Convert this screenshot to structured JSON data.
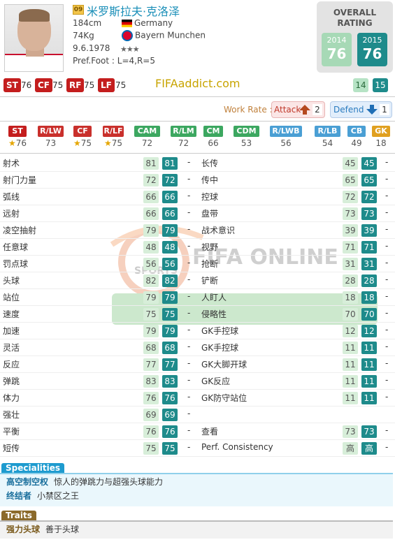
{
  "player": {
    "season_badge": "09",
    "name": "米罗斯拉夫·克洛泽",
    "height": "184cm",
    "weight": "74Kg",
    "birth": "9.6.1978",
    "pref_foot": "Pref.Foot : L=4,R=5",
    "nation": "Germany",
    "club": "Bayern Munchen",
    "stars": "★★★"
  },
  "overall": {
    "title1": "OVERALL",
    "title2": "RATING",
    "y1_label": "2014",
    "y1_value": "76",
    "y2_label": "2015",
    "y2_value": "76"
  },
  "top_positions": [
    {
      "pos": "ST",
      "val": "76"
    },
    {
      "pos": "CF",
      "val": "75"
    },
    {
      "pos": "RF",
      "val": "75"
    },
    {
      "pos": "LF",
      "val": "75"
    }
  ],
  "site": "FIFAaddict.com",
  "small_badges": {
    "a": "14",
    "b": "15"
  },
  "work_rate": {
    "label": "Work Rate :",
    "attack": "Attack",
    "attack_val": "2",
    "defend": "Defend",
    "defend_val": "1"
  },
  "positions": [
    {
      "pos": "ST",
      "val": "76",
      "star": true,
      "color": "#c41e1e"
    },
    {
      "pos": "R/LW",
      "val": "73",
      "star": false,
      "color": "#c9302c"
    },
    {
      "pos": "CF",
      "val": "75",
      "star": true,
      "color": "#c9302c"
    },
    {
      "pos": "R/LF",
      "val": "75",
      "star": true,
      "color": "#c9302c"
    },
    {
      "pos": "CAM",
      "val": "72",
      "star": false,
      "color": "#3ca760"
    },
    {
      "pos": "R/LM",
      "val": "72",
      "star": false,
      "color": "#3ca760"
    },
    {
      "pos": "CM",
      "val": "66",
      "star": false,
      "color": "#3ca760"
    },
    {
      "pos": "CDM",
      "val": "53",
      "star": false,
      "color": "#3ca760"
    },
    {
      "pos": "R/LWB",
      "val": "56",
      "star": false,
      "color": "#4a9fd4"
    },
    {
      "pos": "R/LB",
      "val": "54",
      "star": false,
      "color": "#4a9fd4"
    },
    {
      "pos": "CB",
      "val": "49",
      "star": false,
      "color": "#4a9fd4"
    },
    {
      "pos": "GK",
      "val": "18",
      "star": false,
      "color": "#e0a020"
    }
  ],
  "stats_left": [
    {
      "name": "射术",
      "v1": "81",
      "v2": "81"
    },
    {
      "name": "射门力量",
      "v1": "72",
      "v2": "72"
    },
    {
      "name": "弧线",
      "v1": "66",
      "v2": "66"
    },
    {
      "name": "远射",
      "v1": "66",
      "v2": "66"
    },
    {
      "name": "凌空抽射",
      "v1": "79",
      "v2": "79"
    },
    {
      "name": "任意球",
      "v1": "48",
      "v2": "48"
    },
    {
      "name": "罚点球",
      "v1": "56",
      "v2": "56"
    },
    {
      "name": "头球",
      "v1": "82",
      "v2": "82"
    },
    {
      "name": "站位",
      "v1": "79",
      "v2": "79"
    },
    {
      "name": "速度",
      "v1": "75",
      "v2": "75"
    },
    {
      "name": "加速",
      "v1": "79",
      "v2": "79"
    },
    {
      "name": "灵活",
      "v1": "68",
      "v2": "68"
    },
    {
      "name": "反应",
      "v1": "77",
      "v2": "77"
    },
    {
      "name": "弹跳",
      "v1": "83",
      "v2": "83"
    },
    {
      "name": "体力",
      "v1": "76",
      "v2": "76"
    },
    {
      "name": "强壮",
      "v1": "69",
      "v2": "69"
    },
    {
      "name": "平衡",
      "v1": "76",
      "v2": "76"
    },
    {
      "name": "短传",
      "v1": "75",
      "v2": "75"
    }
  ],
  "stats_right": [
    {
      "name": "长传",
      "v1": "45",
      "v2": "45"
    },
    {
      "name": "传中",
      "v1": "65",
      "v2": "65"
    },
    {
      "name": "控球",
      "v1": "72",
      "v2": "72"
    },
    {
      "name": "盘带",
      "v1": "73",
      "v2": "73"
    },
    {
      "name": "战术意识",
      "v1": "39",
      "v2": "39"
    },
    {
      "name": "视野",
      "v1": "71",
      "v2": "71"
    },
    {
      "name": "抢断",
      "v1": "31",
      "v2": "31"
    },
    {
      "name": "铲断",
      "v1": "28",
      "v2": "28"
    },
    {
      "name": "人盯人",
      "v1": "18",
      "v2": "18"
    },
    {
      "name": "侵略性",
      "v1": "70",
      "v2": "70"
    },
    {
      "name": "GK手控球",
      "v1": "12",
      "v2": "12"
    },
    {
      "name": "GK手控球",
      "v1": "11",
      "v2": "11"
    },
    {
      "name": "GK大脚开球",
      "v1": "11",
      "v2": "11"
    },
    {
      "name": "GK反应",
      "v1": "11",
      "v2": "11"
    },
    {
      "name": "GK防守站位",
      "v1": "11",
      "v2": "11"
    },
    {
      "name": "",
      "v1": "",
      "v2": ""
    },
    {
      "name": "查看",
      "v1": "73",
      "v2": "73"
    },
    {
      "name": "Perf. Consistency",
      "v1": "高",
      "v2": "高"
    }
  ],
  "dash": "-",
  "specialities": {
    "title": "Specialities",
    "items": [
      {
        "name": "高空制空权",
        "desc": "惊人的弹跳力与超强头球能力"
      },
      {
        "name": "终结者",
        "desc": "小禁区之王"
      }
    ]
  },
  "traits": {
    "title": "Traits",
    "items": [
      {
        "name": "强力头球",
        "desc": "善于头球"
      }
    ]
  },
  "watermark": {
    "brand": "FIFA ONLINE",
    "sports": "SPORTS"
  }
}
